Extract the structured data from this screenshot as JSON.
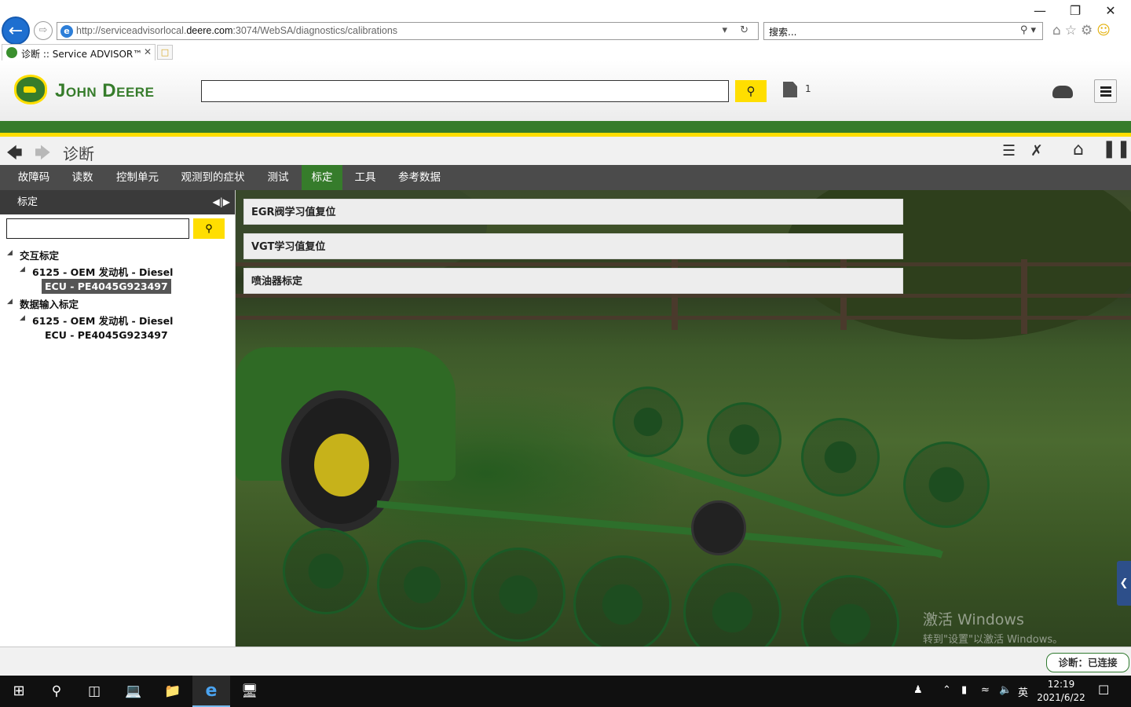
{
  "browser": {
    "url_prefix": "http://serviceadvisorlocal.",
    "url_domain": "deere.com",
    "url_suffix": ":3074/WebSA/diagnostics/calibrations",
    "search_placeholder": "搜索...",
    "tab_title": "诊断 :: Service ADVISOR™"
  },
  "header": {
    "brand": "John Deere",
    "work_orders_count": "1"
  },
  "page": {
    "title": "诊断"
  },
  "tabs": [
    {
      "label": "故障码"
    },
    {
      "label": "读数"
    },
    {
      "label": "控制单元"
    },
    {
      "label": "观测到的症状"
    },
    {
      "label": "测试"
    },
    {
      "label": "标定",
      "active": true
    },
    {
      "label": "工具"
    },
    {
      "label": "参考数据"
    }
  ],
  "left_panel": {
    "title": "标定",
    "tree": {
      "group1": "交互标定",
      "group1_machine": "6125 - OEM 发动机 - Diesel",
      "group1_ecu": "ECU - PE4045G923497",
      "group2": "数据输入标定",
      "group2_machine": "6125 - OEM 发动机 - Diesel",
      "group2_ecu": "ECU - PE4045G923497"
    }
  },
  "calibrations": [
    {
      "label": "EGR阀学习值复位"
    },
    {
      "label": "VGT学习值复位"
    },
    {
      "label": "喷油器标定"
    }
  ],
  "watermark": {
    "line1": "激活 Windows",
    "line2": "转到\"设置\"以激活 Windows。"
  },
  "status": {
    "connection": "诊断：已连接"
  },
  "taskbar": {
    "time": "12:19",
    "date": "2021/6/22",
    "ime": "英"
  },
  "colors": {
    "brand_green": "#367c2b",
    "brand_yellow": "#ffde00",
    "tab_bar": "#4b4b4b"
  }
}
